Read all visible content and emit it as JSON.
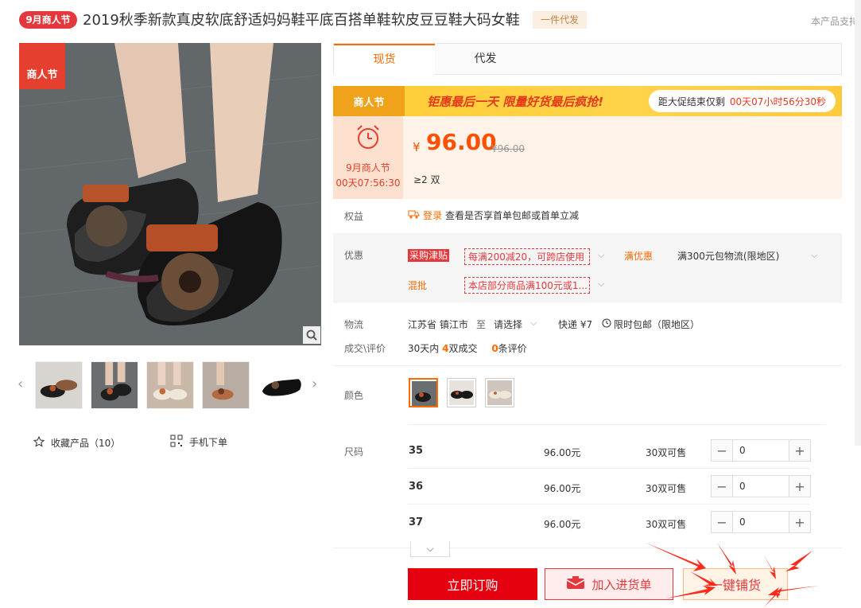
{
  "header": {
    "badge": "9月商人节",
    "title": "2019秋季新款真皮软底舒适妈妈鞋平底百搭单鞋软皮豆豆鞋大码女鞋",
    "tag": "一件代发",
    "right_note": "本产品支持"
  },
  "gallery": {
    "corner_badge": "商人节",
    "thumbs": [
      "thumb-1",
      "thumb-2",
      "thumb-3",
      "thumb-4",
      "thumb-5"
    ],
    "fav_label": "收藏产品（10）",
    "mobile_label": "手机下单"
  },
  "tabs": [
    {
      "label": "现货",
      "active": true
    },
    {
      "label": "代发",
      "active": false
    }
  ],
  "banner": {
    "logo": "商人节",
    "slogan": "钜惠最后一天 限量好货最后疯抢!",
    "timer_label": "距大促结束仅剩",
    "countdown": "00天07小时56分30秒"
  },
  "price": {
    "festival_name": "9月商人节",
    "festival_time": "00天07:56:30",
    "symbol": "¥",
    "value": "96.00",
    "old": "¥96.00",
    "min_qty": "≥2 双"
  },
  "rights": {
    "label": "权益",
    "login": "登录",
    "text": "查看是否享首单包邮或首单立减"
  },
  "promo": {
    "label": "优惠",
    "purchase_tag": "采购津贴",
    "purchase_text": "每满200减20，可跨店使用",
    "manyouhui_label": "满优惠",
    "manyouhui_text": "满300元包物流(限地区)",
    "hunpi_label": "混批",
    "hunpi_text": "本店部分商品满100元或1..."
  },
  "logistics": {
    "label": "物流",
    "from": "江苏省 镇江市",
    "to_word": "至",
    "to_select": "请选择",
    "express": "快递 ¥7",
    "free": "限时包邮（限地区）"
  },
  "deals": {
    "label": "成交\\评价",
    "days_prefix": "30天内",
    "deals_count": "4",
    "deals_suffix": "双成交",
    "reviews_count": "0",
    "reviews_suffix": "条评价"
  },
  "color": {
    "label": "颜色"
  },
  "sizes": {
    "label": "尺码",
    "rows": [
      {
        "size": "35",
        "price": "96.00元",
        "stock": "30双可售",
        "qty": "0"
      },
      {
        "size": "36",
        "price": "96.00元",
        "stock": "30双可售",
        "qty": "0"
      },
      {
        "size": "37",
        "price": "96.00元",
        "stock": "30双可售",
        "qty": "0"
      }
    ]
  },
  "actions": {
    "buy": "立即订购",
    "cart": "加入进货单",
    "onekey": "一键铺货"
  },
  "colors": {
    "accent": "#ff6a00",
    "red": "#e4393c",
    "price": "#ff5000"
  }
}
